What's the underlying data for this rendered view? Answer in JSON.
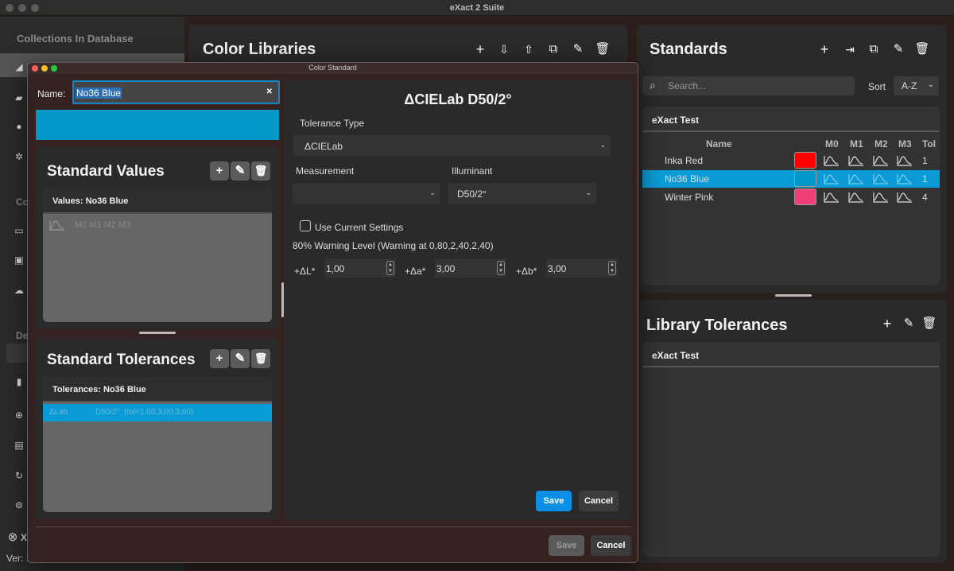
{
  "app": {
    "title": "eXact 2 Suite"
  },
  "sidebar": {
    "header": "Collections In Database",
    "section_partial_1": "Co",
    "section_partial_2": "De",
    "version_partial": "Ver: 1",
    "logo_partial": "X"
  },
  "libraries": {
    "title": "Color Libraries"
  },
  "standards": {
    "title": "Standards",
    "search_placeholder": "Search...",
    "sort_label": "Sort",
    "sort_value": "A-Z",
    "group": "eXact Test",
    "columns": {
      "name": "Name",
      "m0": "M0",
      "m1": "M1",
      "m2": "M2",
      "m3": "M3",
      "tol": "Tol"
    },
    "rows": [
      {
        "name": "Inka Red",
        "color": "#fe0000",
        "tol": "1",
        "selected": false
      },
      {
        "name": "No36 Blue",
        "color": "#0398c8",
        "tol": "1",
        "selected": true
      },
      {
        "name": "Winter Pink",
        "color": "#f0407a",
        "tol": "4",
        "selected": false
      }
    ]
  },
  "library_tolerances": {
    "title": "Library Tolerances",
    "group": "eXact Test"
  },
  "dialog": {
    "title": "Color Standard",
    "name_label": "Name:",
    "name_value": "No36 Blue",
    "preview_color": "#0398c8",
    "standard_values": {
      "title": "Standard Values",
      "card_header": "Values: No36 Blue",
      "row_text": "M0 M1 M2 M3"
    },
    "standard_tolerances": {
      "title": "Standard Tolerances",
      "card_header": "Tolerances: No36 Blue",
      "row_type": "ΔLab",
      "row_detail": "D50/2°  (tol=1,00,3,00,3,00)"
    },
    "tolerance": {
      "heading": "ΔCIELab D50/2°",
      "type_label": "Tolerance Type",
      "type_value": "ΔCIELab",
      "measurement_label": "Measurement",
      "measurement_value": "",
      "illuminant_label": "Illuminant",
      "illuminant_value": "D50/2°",
      "use_current_label": "Use Current Settings",
      "warning_text": "80% Warning Level (Warning at 0,80,2,40,2,40)",
      "dl_label": "+ΔL*",
      "dl_value": "1,00",
      "da_label": "+Δa*",
      "da_value": "3,00",
      "db_label": "+Δb*",
      "db_value": "3,00",
      "save": "Save",
      "cancel": "Cancel"
    },
    "footer_save": "Save",
    "footer_cancel": "Cancel"
  }
}
